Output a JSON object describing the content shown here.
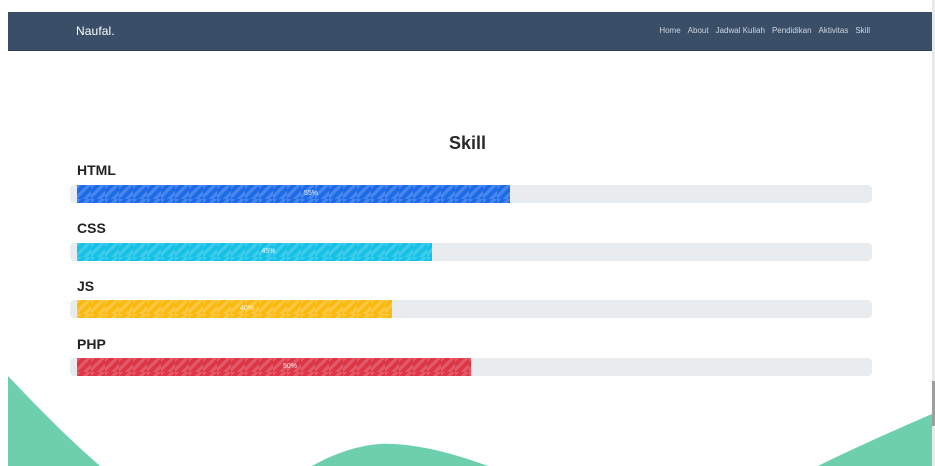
{
  "navbar": {
    "brand": "Naufal.",
    "links": [
      "Home",
      "About",
      "Jadwal Kuliah",
      "Pendidikan",
      "Aktivitas",
      "Skill"
    ]
  },
  "main": {
    "title": "Skill",
    "skills": [
      {
        "name": "HTML",
        "percent": 55,
        "label": "55%",
        "color": "#1e6be8"
      },
      {
        "name": "CSS",
        "percent": 45,
        "label": "45%",
        "color": "#15c1e6"
      },
      {
        "name": "JS",
        "percent": 40,
        "label": "40%",
        "color": "#fbb80f"
      },
      {
        "name": "PHP",
        "percent": 50,
        "label": "50%",
        "color": "#dc3545"
      }
    ]
  },
  "colors": {
    "navbar": "#3a4e68",
    "wave": "#6ecfad",
    "track": "#e9ecef"
  }
}
